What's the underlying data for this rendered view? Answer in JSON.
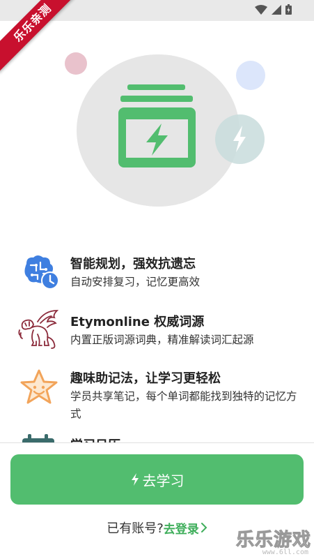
{
  "ribbon": {
    "text": "乐乐亲测"
  },
  "features": [
    {
      "title": "智能规划，强效抗遗忘",
      "desc": "自动安排复习，记忆更高效",
      "icon": "brain-clock-icon"
    },
    {
      "title": "Etymonline 权威词源",
      "desc": "内置正版词源词典，精准解读词汇起源",
      "icon": "winged-lion-icon"
    },
    {
      "title": "趣味助记法，让学习更轻松",
      "desc": "学员共享笔记，每个单词都能找到独特的记忆方式",
      "icon": "smiling-star-icon"
    },
    {
      "title": "学习日历",
      "desc": "",
      "icon": "calendar-icon"
    }
  ],
  "study_button": {
    "label": "去学习"
  },
  "login": {
    "prompt": "已有账号?",
    "link": "去登录"
  },
  "watermark": {
    "text": "乐乐游戏",
    "url": "www.6ll.com"
  },
  "colors": {
    "accent": "#52bd6f",
    "ribbon": "#c8102e",
    "link": "#3fae5b"
  }
}
